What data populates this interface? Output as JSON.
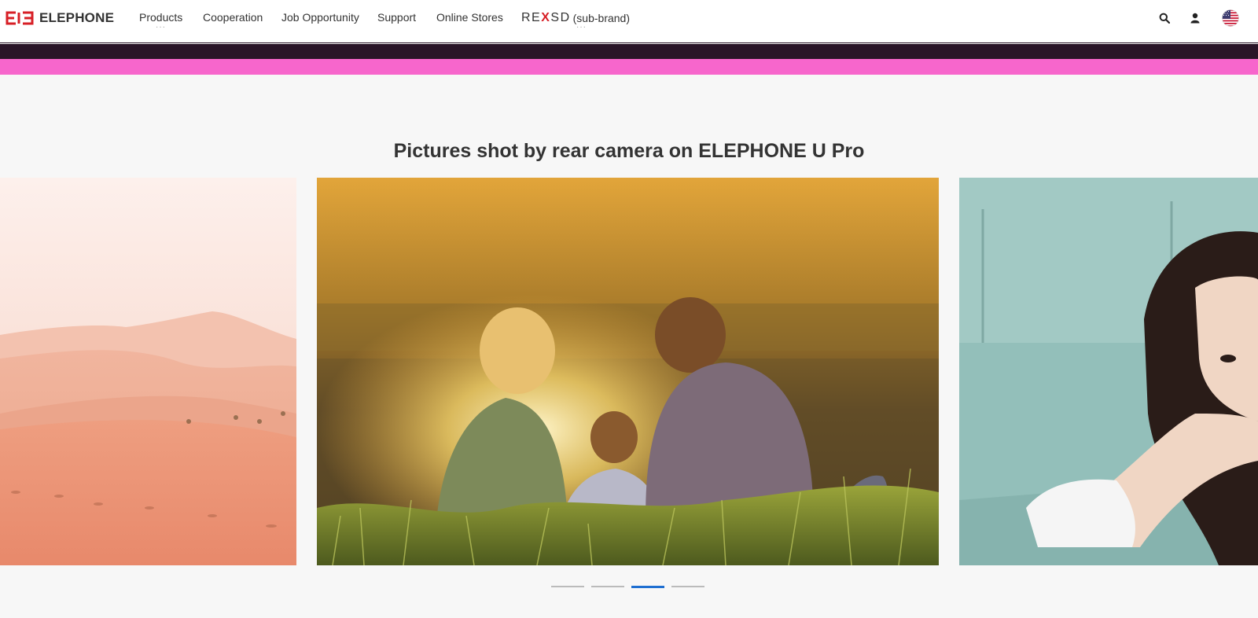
{
  "brand": {
    "name": "ELEPHONE",
    "logo_color": "#d71f26"
  },
  "nav": {
    "products": "Products",
    "cooperation": "Cooperation",
    "job": "Job Opportunity",
    "support": "Support",
    "stores": "Online Stores",
    "subbrand_logo_left": "RE",
    "subbrand_logo_x": "X",
    "subbrand_logo_right": "SD",
    "subbrand_label": "(sub-brand)",
    "more_dots": "···"
  },
  "header_icons": [
    "search-icon",
    "user-icon",
    "us-flag-icon"
  ],
  "banner": {
    "dark_color": "#2a1528",
    "pink_color": "#f766cc"
  },
  "gallery": {
    "title": "Pictures shot by rear camera on ELEPHONE U Pro",
    "slides": [
      "desert-dunes-photo",
      "family-by-lake-photo",
      "woman-on-sofa-photo"
    ],
    "active_dot": 3,
    "dot_count": 4,
    "active_color": "#1f6fd1"
  }
}
